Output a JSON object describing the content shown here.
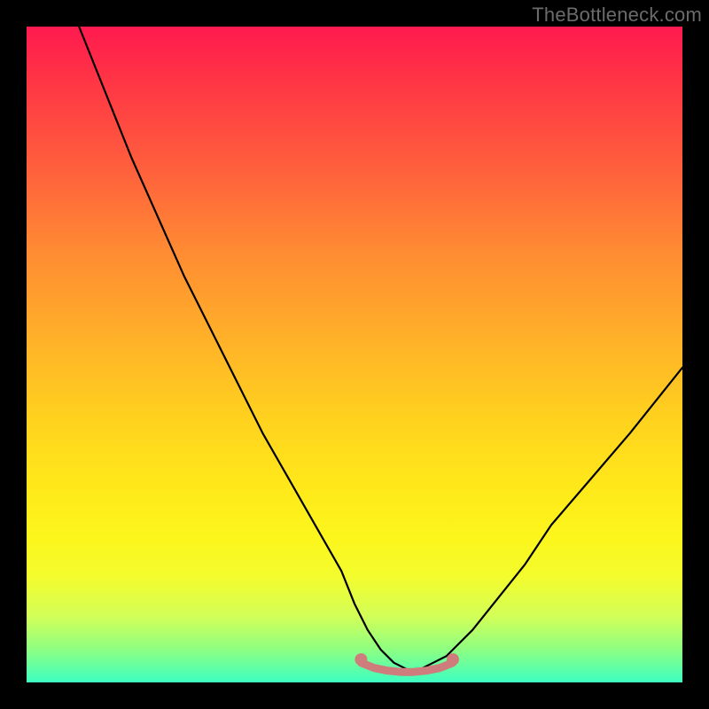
{
  "watermark": {
    "text": "TheBottleneck.com"
  },
  "chart_data": {
    "type": "line",
    "title": "",
    "xlabel": "",
    "ylabel": "",
    "xlim": [
      0,
      100
    ],
    "ylim": [
      0,
      100
    ],
    "gradient_colors": [
      "#ff1a4f",
      "#3dffc2"
    ],
    "series": [
      {
        "name": "bottleneck-curve",
        "color": "#000000",
        "x": [
          8,
          12,
          16,
          20,
          24,
          28,
          32,
          36,
          40,
          44,
          48,
          50,
          52,
          54,
          56,
          58,
          60,
          62,
          64,
          68,
          72,
          76,
          80,
          86,
          92,
          100
        ],
        "y": [
          100,
          90,
          80,
          71,
          62,
          54,
          46,
          38,
          31,
          24,
          17,
          12,
          8,
          5,
          3,
          2,
          2,
          3,
          4,
          8,
          13,
          18,
          24,
          31,
          38,
          48
        ]
      },
      {
        "name": "optimal-flat-segment",
        "color": "#ce7c7c",
        "x": [
          51,
          53,
          55,
          57,
          59,
          61,
          63,
          65
        ],
        "y": [
          3,
          2.2,
          1.8,
          1.6,
          1.6,
          1.8,
          2.2,
          3
        ]
      }
    ],
    "markers": [
      {
        "name": "optimal-start-marker",
        "x": 51,
        "y": 3.5,
        "color": "#ce7c7c"
      },
      {
        "name": "optimal-end-marker",
        "x": 65,
        "y": 3.5,
        "color": "#ce7c7c"
      }
    ]
  }
}
